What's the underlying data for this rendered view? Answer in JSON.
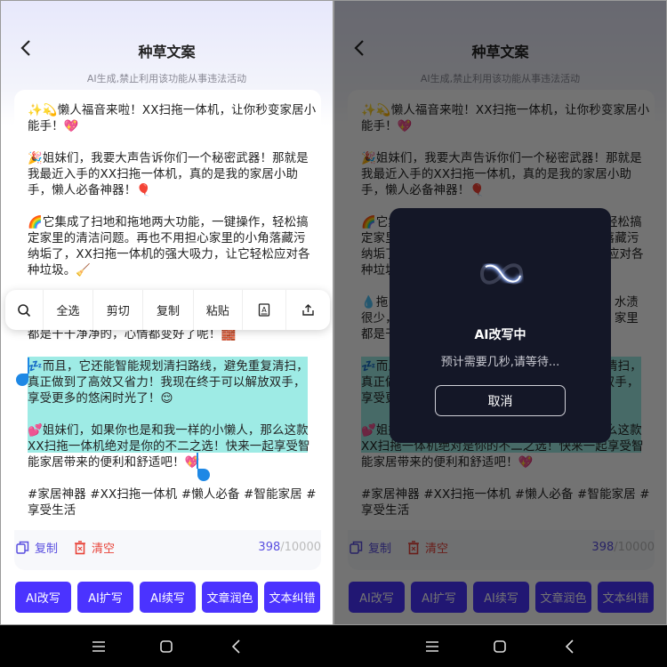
{
  "header": {
    "title": "种草文案",
    "subtitle": "AI生成,禁止利用该功能从事违法活动"
  },
  "content": {
    "paragraphs": [
      [
        "✨💫懒人福音来啦！XX扫拖一体机，让你秒变家居小",
        "能手！💖"
      ],
      [
        "🎉姐妹们，我要大声告诉你们一个秘密武器！那就是",
        "我最近入手的XX扫拖一体机，真的是我的家居小助",
        "手，懒人必备神器！🎈"
      ],
      [
        "🌈它集成了扫地和拖地两大功能，一键操作，轻松搞",
        "定家里的清洁问题。再也不用担心家里的小角落藏污",
        "纳垢了，XX扫拖一体机的强大吸力，让它轻松应对各",
        "种垃圾。🧹"
      ],
      [
        "",
        "",
        "都是干干净净的，心情都变好了呢！🧱"
      ],
      [
        "💤而且，它还能智能规划清扫路线，避免重复清扫，",
        "真正做到了高效又省力！我现在终于可以解放双手，",
        "享受更多的悠闲时光了！😌"
      ],
      [
        "💕姐妹们，如果你也是和我一样的小懒人，那么这款",
        "XX扫拖一体机绝对是你的不二之选！快来一起享受智",
        "能家居带来的便利和舒适吧！💖"
      ],
      [
        "#家居神器 #XX扫拖一体机 #懒人必备 #智能家居 #",
        "享受生活"
      ]
    ],
    "hidden_paragraph_fragments": {
      "l1_start": "💧拖",
      "l1_end": "水渍",
      "l2_start": "很少，",
      "l2_end": "家里",
      "l3_start": "都是干"
    }
  },
  "toolbar": {
    "items": [
      "全选",
      "剪切",
      "复制",
      "粘贴"
    ],
    "icons": [
      "search-icon",
      "dictionary-icon",
      "share-icon"
    ]
  },
  "footer": {
    "copy_label": "复制",
    "clear_label": "清空",
    "count": "398",
    "max": "/10000"
  },
  "actions": [
    "AI改写",
    "AI扩写",
    "AI续写",
    "文章润色",
    "文本纠错"
  ],
  "modal": {
    "title": "AI改写中",
    "message": "预计需要几秒,请等待...",
    "cancel_label": "取消"
  },
  "colors": {
    "accent": "#4b33ff",
    "danger": "#e8443a",
    "selection": "#9eebe5",
    "modal_bg": "#141727"
  }
}
